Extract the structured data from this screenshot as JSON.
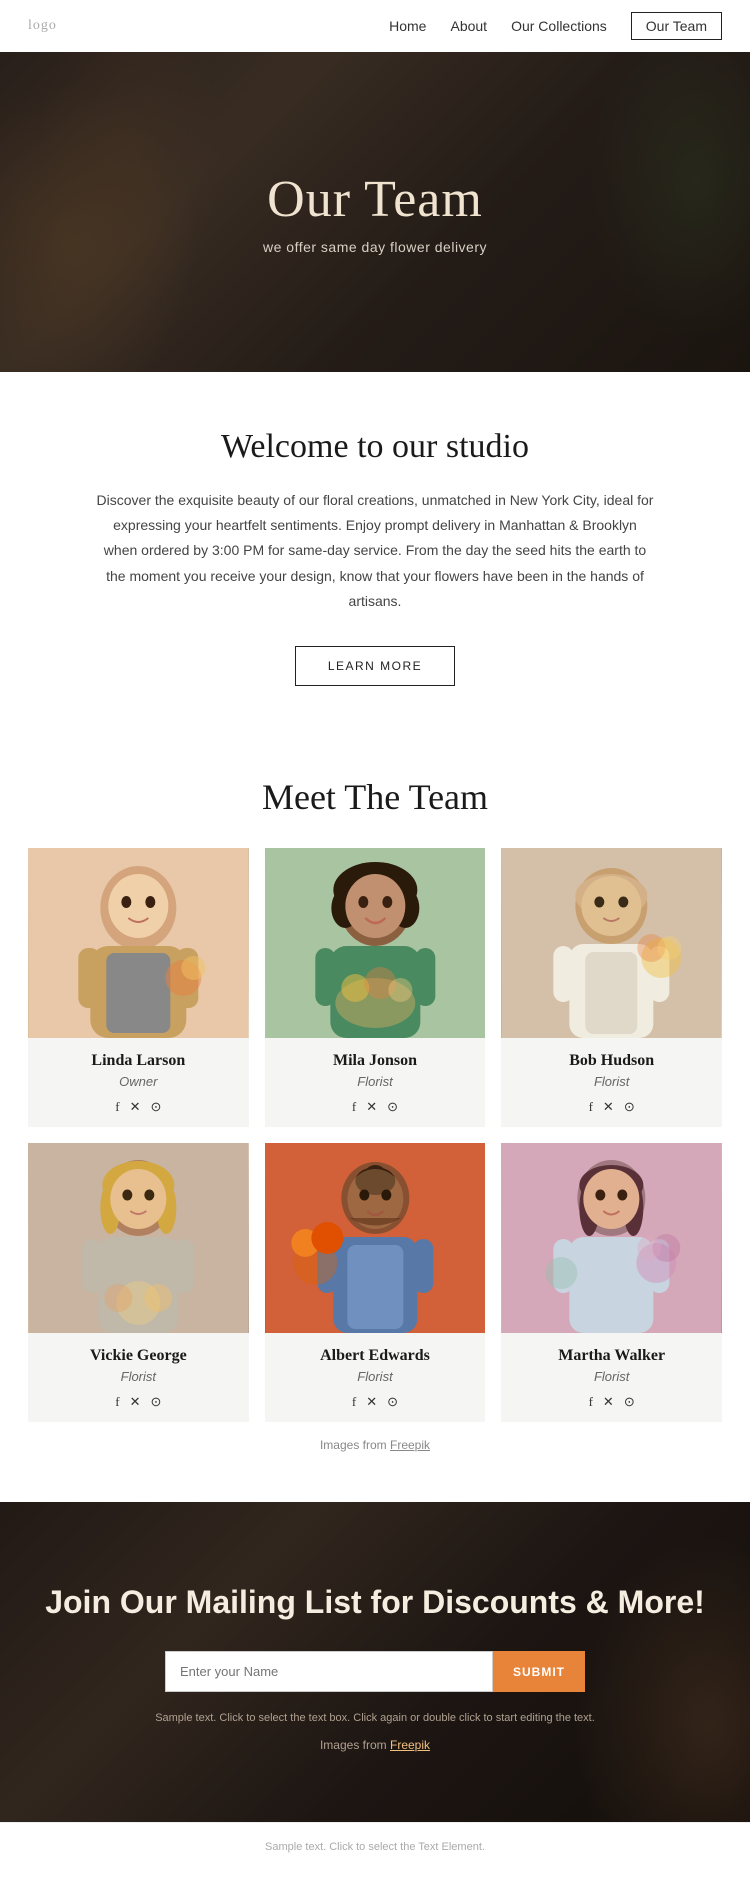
{
  "nav": {
    "logo": "logo",
    "links": [
      {
        "label": "Home",
        "active": false
      },
      {
        "label": "About",
        "active": false
      },
      {
        "label": "Our Collections",
        "active": false
      },
      {
        "label": "Our Team",
        "active": true
      }
    ]
  },
  "hero": {
    "title": "Our Team",
    "subtitle": "we offer same day flower delivery"
  },
  "studio": {
    "heading": "Welcome to our studio",
    "body": "Discover the exquisite beauty of our floral creations, unmatched in New York City, ideal for expressing your heartfelt sentiments. Enjoy prompt delivery in Manhattan & Brooklyn when ordered by 3:00 PM for same-day service.  From the day the seed hits the earth to the moment you receive your design, know that your flowers have been in the hands of artisans.",
    "button_label": "LEARN MORE"
  },
  "team_section": {
    "heading": "Meet The Team",
    "image_credit_prefix": "Images from ",
    "image_credit_link": "Freepik",
    "members": [
      {
        "name": "Linda Larson",
        "role": "Owner",
        "img_class": "img-linda"
      },
      {
        "name": "Mila Jonson",
        "role": "Florist",
        "img_class": "img-mila"
      },
      {
        "name": "Bob Hudson",
        "role": "Florist",
        "img_class": "img-bob"
      },
      {
        "name": "Vickie George",
        "role": "Florist",
        "img_class": "img-vickie"
      },
      {
        "name": "Albert Edwards",
        "role": "Florist",
        "img_class": "img-albert"
      },
      {
        "name": "Martha Walker",
        "role": "Florist",
        "img_class": "img-martha"
      }
    ]
  },
  "mailing": {
    "heading": "Join Our Mailing List for Discounts & More!",
    "input_placeholder": "Enter your Name",
    "button_label": "SUBMIT",
    "sample_text": "Sample text. Click to select the text box. Click again or double click to start editing the text.",
    "image_credit_prefix": "Images from ",
    "image_credit_link": "Freepik"
  },
  "footer": {
    "sample_text": "Sample text. Click to select the Text Element."
  },
  "social": {
    "facebook": "f",
    "twitter": "✕",
    "instagram": "⊙"
  },
  "colors": {
    "accent": "#e8843a",
    "dark": "#1a1510",
    "light_text": "#f5ede0"
  }
}
